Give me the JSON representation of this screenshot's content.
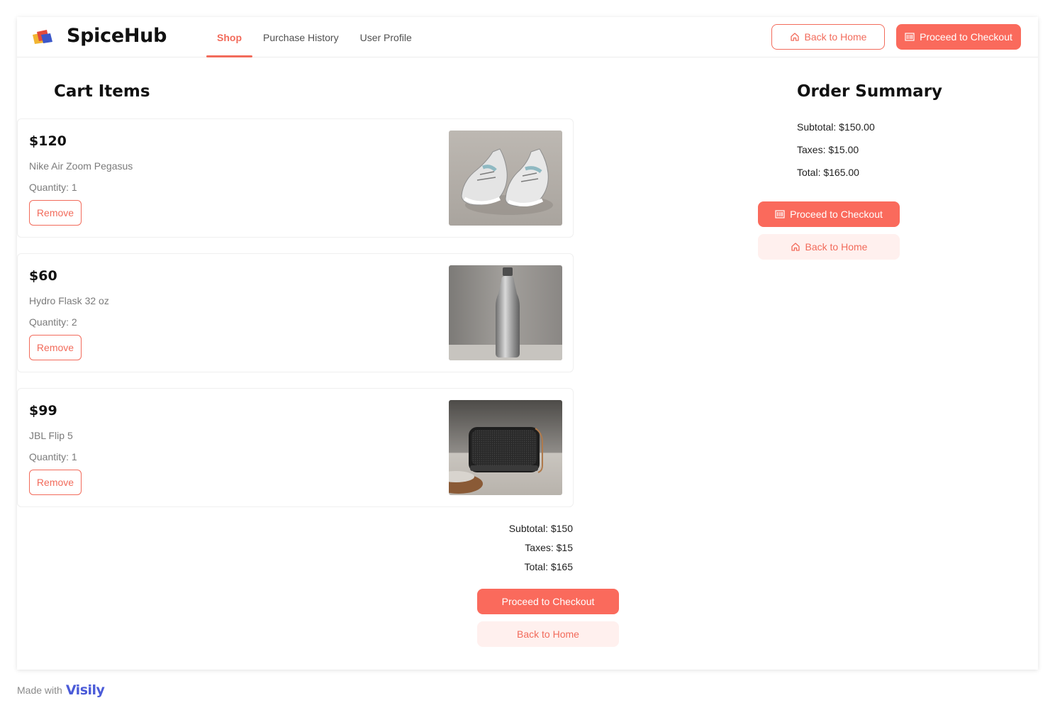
{
  "header": {
    "brand": "SpiceHub",
    "tabs": [
      {
        "label": "Shop",
        "active": true
      },
      {
        "label": "Purchase History",
        "active": false
      },
      {
        "label": "User Profile",
        "active": false
      }
    ],
    "back_home_label": "Back to Home",
    "checkout_label": "Proceed to Checkout"
  },
  "cart": {
    "title": "Cart Items",
    "items": [
      {
        "price": "$120",
        "name": "Nike Air Zoom Pegasus",
        "quantity": "Quantity: 1",
        "remove_label": "Remove",
        "image": "sneakers-photo"
      },
      {
        "price": "$60",
        "name": "Hydro Flask 32 oz",
        "quantity": "Quantity: 2",
        "remove_label": "Remove",
        "image": "water-bottle-photo"
      },
      {
        "price": "$99",
        "name": "JBL Flip 5",
        "quantity": "Quantity: 1",
        "remove_label": "Remove",
        "image": "speaker-photo"
      }
    ],
    "subtotal": "Subtotal: $150",
    "taxes": "Taxes: $15",
    "total": "Total: $165",
    "checkout_label": "Proceed to Checkout",
    "back_home_label": "Back to Home"
  },
  "summary": {
    "title": "Order Summary",
    "subtotal": "Subtotal: $150.00",
    "taxes": "Taxes: $15.00",
    "total": "Total: $165.00",
    "checkout_label": "Proceed to Checkout",
    "back_home_label": "Back to Home"
  },
  "footer": {
    "made_with": "Made with",
    "brand": "Visily"
  },
  "colors": {
    "accent": "#fa6a5c",
    "accent_soft": "#fff0ee",
    "text": "#1f1f1f",
    "muted": "#7b7b7b"
  }
}
